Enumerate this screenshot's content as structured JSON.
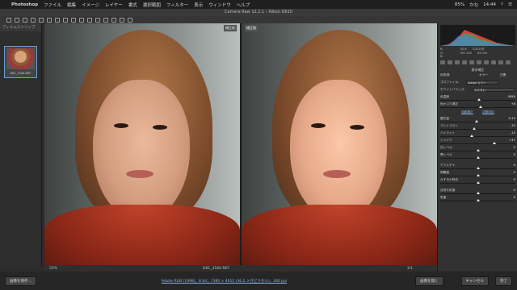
{
  "menubar": {
    "app": "Photoshop",
    "items": [
      "ファイル",
      "編集",
      "イメージ",
      "レイヤー",
      "書式",
      "選択範囲",
      "フィルター",
      "表示",
      "ウィンドウ",
      "ヘルプ"
    ],
    "battery": "85%",
    "time": "14:44",
    "input_method": "かな"
  },
  "window_title": "Camera Raw 12.2.1 – Nikon D810",
  "filmstrip": {
    "label": "フィルムストリップ",
    "filename": "D81_3184.NEF"
  },
  "view": {
    "before_label": "補正前",
    "after_label": "補正後"
  },
  "stage_footer": {
    "zoom": "50%",
    "filename": "D81_3184.NEF",
    "pages": "1/1"
  },
  "panel": {
    "exif": {
      "r": "R:",
      "g": "G:",
      "b": "B:",
      "aperture": "f/2.8",
      "shutter": "1/320 秒",
      "iso": "ISO 200",
      "focal": "85 mm"
    },
    "section_title": "基本補正",
    "treatment": {
      "label": "色表現:",
      "color": "カラー",
      "bw": "白黒"
    },
    "profile": {
      "label": "プロファイル:",
      "value": "Adobe カラー"
    },
    "white_balance": {
      "label": "ホワイトバランス:",
      "value": "カスタム"
    },
    "auto": "自動補正",
    "default": "初期設定",
    "sliders": [
      {
        "label": "色温度",
        "value": "5650",
        "pos": 0.52
      },
      {
        "label": "色かぶり補正",
        "value": "+8",
        "pos": 0.54
      },
      {
        "label": "露光量",
        "value": "-0.15",
        "pos": 0.48
      },
      {
        "label": "コントラスト",
        "value": "-10",
        "pos": 0.45
      },
      {
        "label": "ハイライト",
        "value": "-15",
        "pos": 0.42
      },
      {
        "label": "シャドウ",
        "value": "+47",
        "pos": 0.72
      },
      {
        "label": "白レベル",
        "value": "0",
        "pos": 0.5
      },
      {
        "label": "黒レベル",
        "value": "0",
        "pos": 0.5
      },
      {
        "label": "テクスチャ",
        "value": "0",
        "pos": 0.5
      },
      {
        "label": "明瞭度",
        "value": "0",
        "pos": 0.5
      },
      {
        "label": "かすみの除去",
        "value": "0",
        "pos": 0.5
      },
      {
        "label": "自然な彩度",
        "value": "0",
        "pos": 0.5
      },
      {
        "label": "彩度",
        "value": "0",
        "pos": 0.5
      }
    ]
  },
  "bottom": {
    "save": "画像を保存...",
    "workflow": "Adobe RGB (1998)；8 bit；7360 × 4912 (36.2 メガピクセル)；300 ppi",
    "open": "画像を開く",
    "cancel": "キャンセル",
    "done": "完了"
  }
}
